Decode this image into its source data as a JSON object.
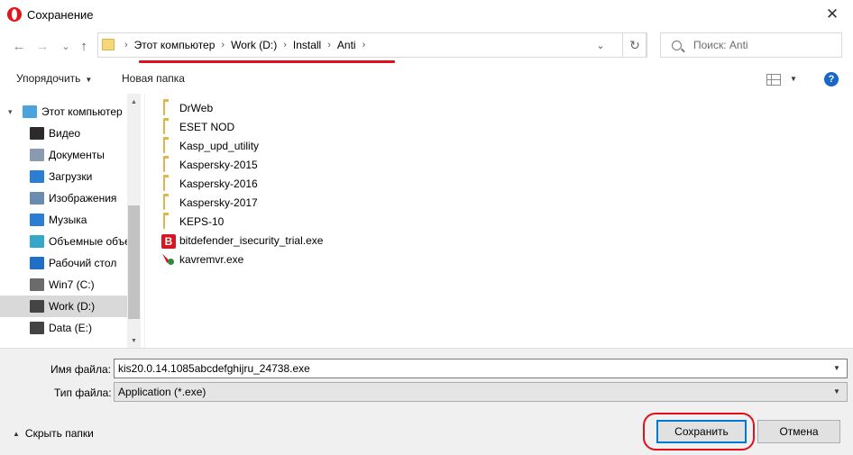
{
  "window": {
    "title": "Сохранение",
    "close_glyph": "✕"
  },
  "nav": {
    "back_glyph": "←",
    "forward_glyph": "→",
    "recent_glyph": "⌄",
    "up_glyph": "↑",
    "breadcrumbs": [
      "Этот компьютер",
      "Work (D:)",
      "Install",
      "Anti"
    ],
    "crumb_sep": "›",
    "dropdown_glyph": "⌄",
    "refresh_glyph": "↻",
    "search_placeholder": "Поиск: Anti"
  },
  "toolbar": {
    "organize_label": "Упорядочить",
    "new_folder_label": "Новая папка",
    "help_label": "?"
  },
  "sidebar": {
    "items": [
      {
        "label": "Этот компьютер",
        "icon": "computer-icon",
        "color": "#4aa3df",
        "top": true
      },
      {
        "label": "Видео",
        "icon": "video-icon",
        "color": "#2b2b2b"
      },
      {
        "label": "Документы",
        "icon": "documents-icon",
        "color": "#8a9bb0"
      },
      {
        "label": "Загрузки",
        "icon": "downloads-icon",
        "color": "#2a7fd4"
      },
      {
        "label": "Изображения",
        "icon": "pictures-icon",
        "color": "#6a8cae"
      },
      {
        "label": "Музыка",
        "icon": "music-icon",
        "color": "#2a7fd4"
      },
      {
        "label": "Объемные объекты",
        "icon": "3d-objects-icon",
        "color": "#35a7c8"
      },
      {
        "label": "Рабочий стол",
        "icon": "desktop-icon",
        "color": "#1d6fc7"
      },
      {
        "label": "Win7 (C:)",
        "icon": "system-drive-icon",
        "color": "#6b6b6b"
      },
      {
        "label": "Work (D:)",
        "icon": "drive-icon",
        "color": "#444444",
        "selected": true
      },
      {
        "label": "Data (E:)",
        "icon": "drive-icon",
        "color": "#444444"
      }
    ]
  },
  "files": [
    {
      "name": "DrWeb",
      "type": "folder"
    },
    {
      "name": "ESET NOD",
      "type": "folder"
    },
    {
      "name": "Kasp_upd_utility",
      "type": "folder"
    },
    {
      "name": "Kaspersky-2015",
      "type": "folder"
    },
    {
      "name": "Kaspersky-2016",
      "type": "folder"
    },
    {
      "name": "Kaspersky-2017",
      "type": "folder"
    },
    {
      "name": "KEPS-10",
      "type": "folder"
    },
    {
      "name": "bitdefender_isecurity_trial.exe",
      "type": "bitdefender-exe"
    },
    {
      "name": "kavremvr.exe",
      "type": "kaspersky-exe"
    }
  ],
  "bottom": {
    "filename_label": "Имя файла:",
    "filename_value": "kis20.0.14.1085abcdefghijru_24738.exe",
    "filetype_label": "Тип файла:",
    "filetype_value": "Application (*.exe)",
    "hide_folders_label": "Скрыть папки",
    "save_label": "Сохранить",
    "cancel_label": "Отмена"
  },
  "colors": {
    "annotation_red": "#e0101b",
    "accent": "#0078d7"
  }
}
